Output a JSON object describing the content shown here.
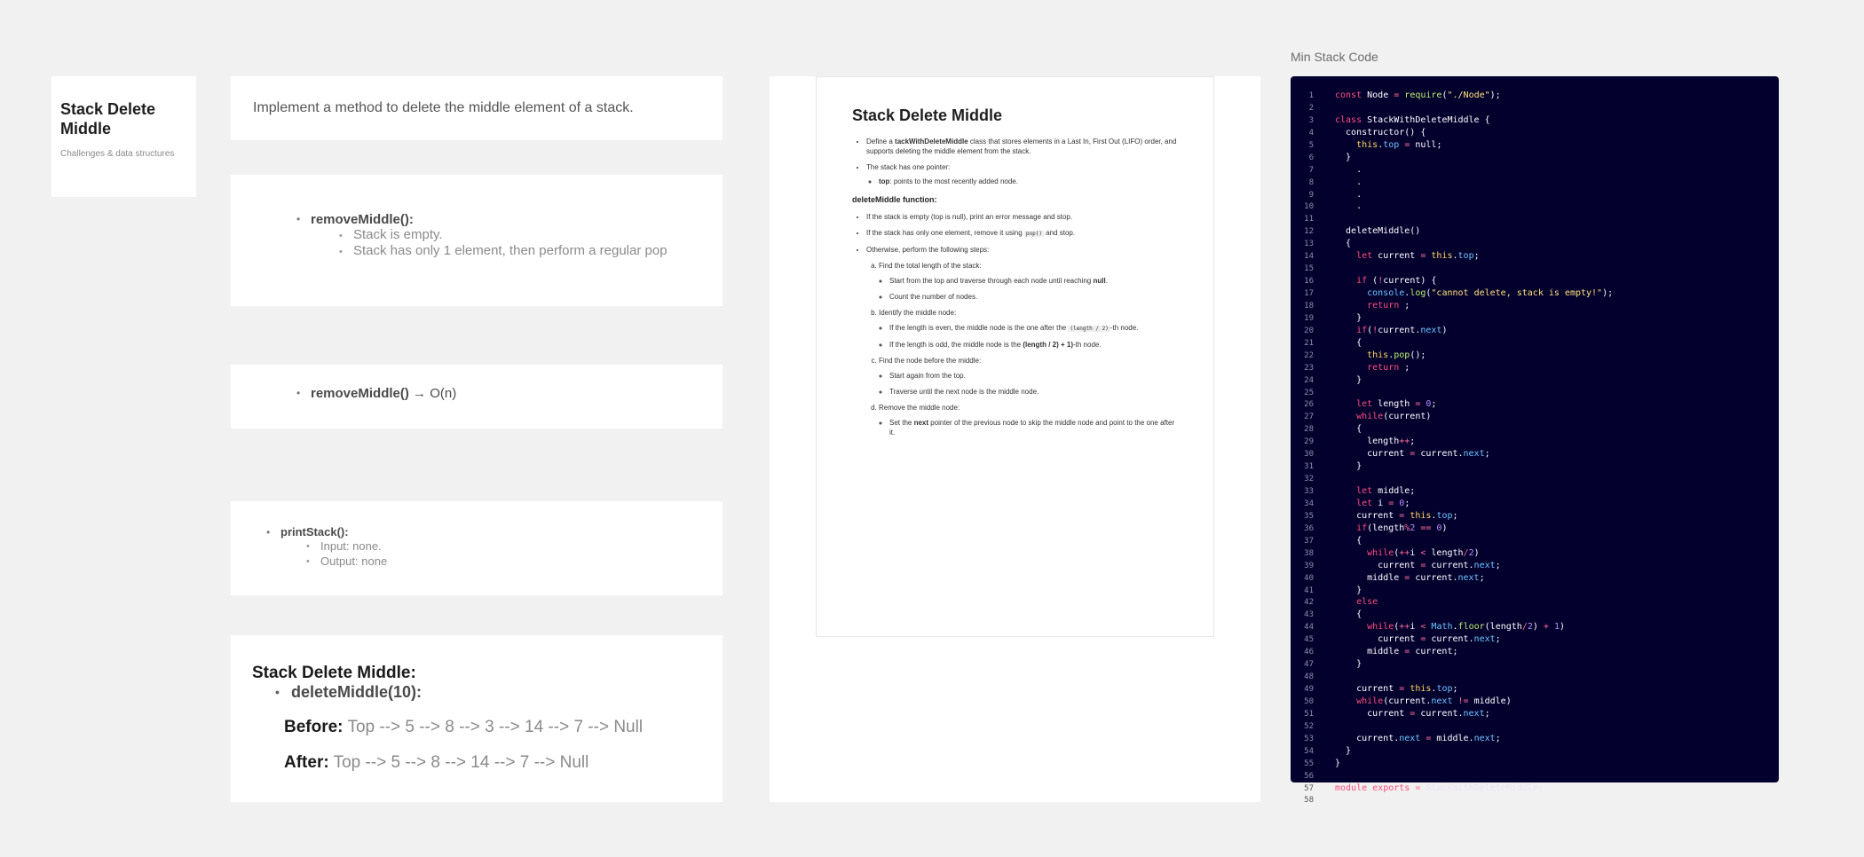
{
  "title_card": {
    "title": "Stack Delete Middle",
    "subtitle": "Challenges & data structures"
  },
  "description": "Implement a method to delete the middle element of a stack.",
  "remove_middle": {
    "heading": "removeMiddle():",
    "items": [
      "Stack is empty.",
      "Stack has only 1 element, then perform a regular pop"
    ]
  },
  "big_o": {
    "method": "removeMiddle()",
    "arrow": "→",
    "complexity": "O(n)"
  },
  "print_stack": {
    "heading": "printStack():",
    "items": [
      "Input: none.",
      "Output: none"
    ]
  },
  "example": {
    "heading": "Stack Delete Middle:",
    "method": "deleteMiddle(10):",
    "before_label": "Before:",
    "before_value": "Top -->  5 --> 8 --> 3 --> 14 --> 7  --> Null",
    "after_label": "After:",
    "after_value": "Top --> 5 --> 8  --> 14 --> 7  --> Null"
  },
  "doc": {
    "title": "Stack Delete Middle",
    "p1_pre": "Define a ",
    "p1_bold": "tackWithDeleteMiddle",
    "p1_post": "  class that stores elements in a Last In, First Out (LIFO) order, and supports deleting the middle element from the stack.",
    "p2": "The stack has one pointer:",
    "p2_sub_bold": "top",
    "p2_sub": ": points to the most recently added node.",
    "fn_heading": "deleteMiddle function:",
    "s1": "If the stack is empty (top is null), print an error message and stop.",
    "s2_pre": "If the stack has only one element, remove it using ",
    "s2_code": "pop()",
    "s2_post": " and stop.",
    "s3": "Otherwise, perform the following steps:",
    "a": "Find the total length of the stack:",
    "a1_pre": "Start from the top and traverse through each node until reaching ",
    "a1_bold": "null",
    "a1_post": ".",
    "a2": "Count the number of nodes.",
    "b": "Identify the middle node:",
    "b1_pre": "If the length is even, the middle node is the one after the ",
    "b1_code": "(length / 2)",
    "b1_post": "-th node.",
    "b2_pre": "If the length is odd, the middle node is the ",
    "b2_bold": "(length / 2) + 1)",
    "b2_post": "-th node.",
    "c": "Find the node before the middle:",
    "c1": "Start again from the top.",
    "c2": "Traverse until the next node is the middle node.",
    "d": "Remove the middle node:",
    "d1_pre": "Set the ",
    "d1_bold": "next",
    "d1_post": " pointer of the previous node to skip the middle node and point to the one after it."
  },
  "code_label": "Min Stack Code",
  "code_lines": [
    "const Node = require(\"./Node\");",
    "",
    "class StackWithDeleteMiddle {",
    "  constructor() {",
    "    this.top = null;",
    "  }",
    "    .",
    "    .",
    "    .",
    "    .",
    "",
    "  deleteMiddle()",
    "  {",
    "    let current = this.top;",
    "",
    "    if (!current) {",
    "      console.log(\"cannot delete, stack is empty!\");",
    "      return ;",
    "    }",
    "    if(!current.next)",
    "    {",
    "      this.pop();",
    "      return ;",
    "    }",
    "",
    "    let length = 0;",
    "    while(current)",
    "    {",
    "      length++;",
    "      current = current.next;",
    "    }",
    "",
    "    let middle;",
    "    let i = 0;",
    "    current = this.top;",
    "    if(length%2 == 0)",
    "    {",
    "      while(++i < length/2)",
    "        current = current.next;",
    "      middle = current.next;",
    "    }",
    "    else",
    "    {",
    "      while(++i < Math.floor(length/2) + 1)",
    "        current = current.next;",
    "      middle = current;",
    "    }",
    "",
    "    current = this.top;",
    "    while(current.next != middle)",
    "      current = current.next;",
    "",
    "    current.next = middle.next;",
    "  }",
    "}",
    "",
    "module.exports = StackWithDeleteMiddle;",
    ""
  ]
}
